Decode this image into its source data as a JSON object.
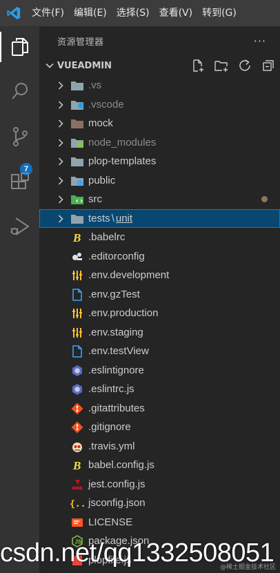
{
  "menu": {
    "app_icon": "vscode-logo-icon",
    "items": [
      "文件(F)",
      "编辑(E)",
      "选择(S)",
      "查看(V)",
      "转到(G)"
    ]
  },
  "activity_bar": {
    "items": [
      {
        "icon": "explorer-files-icon",
        "active": true
      },
      {
        "icon": "search-icon",
        "active": false
      },
      {
        "icon": "source-control-icon",
        "active": false,
        "badge": "7"
      },
      {
        "icon": "extensions-icon",
        "active": false
      },
      {
        "icon": "run-debug-icon",
        "active": false
      }
    ]
  },
  "explorer": {
    "title": "资源管理器",
    "more_label": "···",
    "section_title": "VUEADMIN",
    "section_actions": [
      "new-file-icon",
      "new-folder-icon",
      "refresh-icon",
      "collapse-all-icon"
    ],
    "folders": [
      {
        "name": ".vs",
        "dim": true
      },
      {
        "name": ".vscode",
        "dim": true
      },
      {
        "name": "mock",
        "dim": false
      },
      {
        "name": "node_modules",
        "dim": true
      },
      {
        "name": "plop-templates",
        "dim": false
      },
      {
        "name": "public",
        "dim": false
      },
      {
        "name": "src",
        "dim": false,
        "modified": true
      }
    ],
    "selected_folder": {
      "part1": "tests",
      "sep": "\\",
      "part2": "unit"
    },
    "files": [
      {
        "name": ".babelrc",
        "icon": "babel-icon"
      },
      {
        "name": ".editorconfig",
        "icon": "editorconfig-icon"
      },
      {
        "name": ".env.development",
        "icon": "env-settings-icon"
      },
      {
        "name": ".env.gzTest",
        "icon": "file-icon"
      },
      {
        "name": ".env.production",
        "icon": "env-settings-icon"
      },
      {
        "name": ".env.staging",
        "icon": "env-settings-icon"
      },
      {
        "name": ".env.testView",
        "icon": "file-icon"
      },
      {
        "name": ".eslintignore",
        "icon": "eslint-icon"
      },
      {
        "name": ".eslintrc.js",
        "icon": "eslint-icon"
      },
      {
        "name": ".gitattributes",
        "icon": "git-icon"
      },
      {
        "name": ".gitignore",
        "icon": "git-icon"
      },
      {
        "name": ".travis.yml",
        "icon": "travis-icon"
      },
      {
        "name": "babel.config.js",
        "icon": "babel-icon"
      },
      {
        "name": "jest.config.js",
        "icon": "jest-icon"
      },
      {
        "name": "jsconfig.json",
        "icon": "json-icon"
      },
      {
        "name": "LICENSE",
        "icon": "license-icon"
      },
      {
        "name": "package.json",
        "icon": "nodejs-icon"
      },
      {
        "name": "plopfile.js",
        "icon": "js-icon"
      }
    ]
  },
  "colors": {
    "accent": "#007fd4",
    "selection": "#094771",
    "badge": "#0e70c0",
    "folder": "#90a4ae"
  },
  "watermark": {
    "main": "csdn.net/qq1332508051",
    "small": "@稀土掘金技术社区"
  }
}
